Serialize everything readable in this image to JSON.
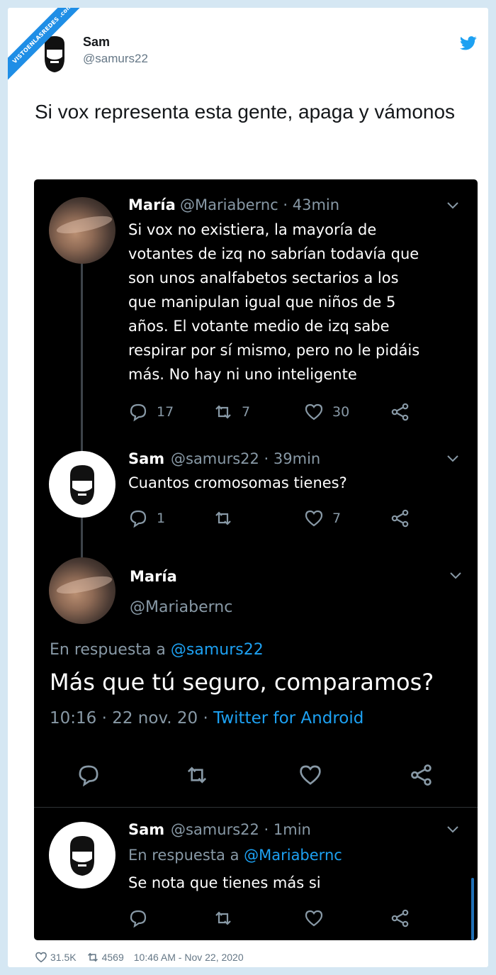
{
  "watermark": "VISTOENLASREDES .com",
  "author": {
    "name": "Sam",
    "handle": "@samurs22",
    "avatar_icon": "bearded-man-avatar-icon",
    "platform_icon": "twitter-bird-icon"
  },
  "tweet_text": "Si vox representa esta gente, apaga y vámonos",
  "screenshot": {
    "t1": {
      "name": "María",
      "meta": "@Mariabernc · 43min",
      "lines": [
        "Si vox no existiera, la mayoría de",
        "votantes de izq no sabrían todavía que",
        "son unos analfabetos sectarios a los",
        "que manipulan igual que niños de 5",
        "años. El votante medio de izq  sabe",
        "respirar por sí mismo, pero no le pidáis",
        "más. No hay ni uno inteligente"
      ],
      "replies": "17",
      "retweets": "7",
      "likes": "30"
    },
    "t2": {
      "name": "Sam",
      "meta": "@samurs22 · 39min",
      "text": "Cuantos cromosomas tienes?",
      "replies": "1",
      "likes": "7"
    },
    "main": {
      "name": "María",
      "handle": "@Mariabernc",
      "reply_prefix": "En respuesta a ",
      "reply_mention": "@samurs22",
      "text": "Más que tú seguro, comparamos?",
      "timestamp": "10:16 · 22 nov. 20 · ",
      "source": "Twitter for Android"
    },
    "t4": {
      "name": "Sam",
      "meta": "@samurs22 · 1min",
      "reply_prefix": "En respuesta a ",
      "reply_mention": "@Mariabernc",
      "text": "Se nota que tienes más si"
    }
  },
  "footer": {
    "likes": "31.5K",
    "retweets": "4569",
    "timestamp": "10:46 AM - Nov 22, 2020"
  },
  "colors": {
    "twitter_blue": "#1da1f2",
    "muted": "#8899a6",
    "background": "#d5e7f3"
  }
}
